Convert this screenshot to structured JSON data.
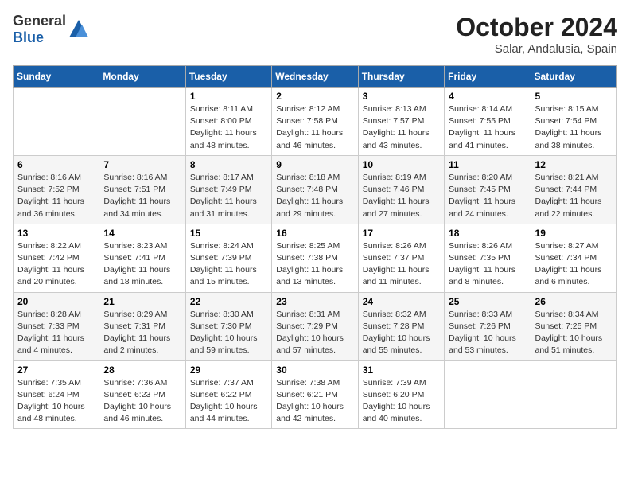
{
  "header": {
    "logo_general": "General",
    "logo_blue": "Blue",
    "month": "October 2024",
    "location": "Salar, Andalusia, Spain"
  },
  "weekdays": [
    "Sunday",
    "Monday",
    "Tuesday",
    "Wednesday",
    "Thursday",
    "Friday",
    "Saturday"
  ],
  "weeks": [
    [
      {
        "day": "",
        "info": ""
      },
      {
        "day": "",
        "info": ""
      },
      {
        "day": "1",
        "info": "Sunrise: 8:11 AM\nSunset: 8:00 PM\nDaylight: 11 hours and 48 minutes."
      },
      {
        "day": "2",
        "info": "Sunrise: 8:12 AM\nSunset: 7:58 PM\nDaylight: 11 hours and 46 minutes."
      },
      {
        "day": "3",
        "info": "Sunrise: 8:13 AM\nSunset: 7:57 PM\nDaylight: 11 hours and 43 minutes."
      },
      {
        "day": "4",
        "info": "Sunrise: 8:14 AM\nSunset: 7:55 PM\nDaylight: 11 hours and 41 minutes."
      },
      {
        "day": "5",
        "info": "Sunrise: 8:15 AM\nSunset: 7:54 PM\nDaylight: 11 hours and 38 minutes."
      }
    ],
    [
      {
        "day": "6",
        "info": "Sunrise: 8:16 AM\nSunset: 7:52 PM\nDaylight: 11 hours and 36 minutes."
      },
      {
        "day": "7",
        "info": "Sunrise: 8:16 AM\nSunset: 7:51 PM\nDaylight: 11 hours and 34 minutes."
      },
      {
        "day": "8",
        "info": "Sunrise: 8:17 AM\nSunset: 7:49 PM\nDaylight: 11 hours and 31 minutes."
      },
      {
        "day": "9",
        "info": "Sunrise: 8:18 AM\nSunset: 7:48 PM\nDaylight: 11 hours and 29 minutes."
      },
      {
        "day": "10",
        "info": "Sunrise: 8:19 AM\nSunset: 7:46 PM\nDaylight: 11 hours and 27 minutes."
      },
      {
        "day": "11",
        "info": "Sunrise: 8:20 AM\nSunset: 7:45 PM\nDaylight: 11 hours and 24 minutes."
      },
      {
        "day": "12",
        "info": "Sunrise: 8:21 AM\nSunset: 7:44 PM\nDaylight: 11 hours and 22 minutes."
      }
    ],
    [
      {
        "day": "13",
        "info": "Sunrise: 8:22 AM\nSunset: 7:42 PM\nDaylight: 11 hours and 20 minutes."
      },
      {
        "day": "14",
        "info": "Sunrise: 8:23 AM\nSunset: 7:41 PM\nDaylight: 11 hours and 18 minutes."
      },
      {
        "day": "15",
        "info": "Sunrise: 8:24 AM\nSunset: 7:39 PM\nDaylight: 11 hours and 15 minutes."
      },
      {
        "day": "16",
        "info": "Sunrise: 8:25 AM\nSunset: 7:38 PM\nDaylight: 11 hours and 13 minutes."
      },
      {
        "day": "17",
        "info": "Sunrise: 8:26 AM\nSunset: 7:37 PM\nDaylight: 11 hours and 11 minutes."
      },
      {
        "day": "18",
        "info": "Sunrise: 8:26 AM\nSunset: 7:35 PM\nDaylight: 11 hours and 8 minutes."
      },
      {
        "day": "19",
        "info": "Sunrise: 8:27 AM\nSunset: 7:34 PM\nDaylight: 11 hours and 6 minutes."
      }
    ],
    [
      {
        "day": "20",
        "info": "Sunrise: 8:28 AM\nSunset: 7:33 PM\nDaylight: 11 hours and 4 minutes."
      },
      {
        "day": "21",
        "info": "Sunrise: 8:29 AM\nSunset: 7:31 PM\nDaylight: 11 hours and 2 minutes."
      },
      {
        "day": "22",
        "info": "Sunrise: 8:30 AM\nSunset: 7:30 PM\nDaylight: 10 hours and 59 minutes."
      },
      {
        "day": "23",
        "info": "Sunrise: 8:31 AM\nSunset: 7:29 PM\nDaylight: 10 hours and 57 minutes."
      },
      {
        "day": "24",
        "info": "Sunrise: 8:32 AM\nSunset: 7:28 PM\nDaylight: 10 hours and 55 minutes."
      },
      {
        "day": "25",
        "info": "Sunrise: 8:33 AM\nSunset: 7:26 PM\nDaylight: 10 hours and 53 minutes."
      },
      {
        "day": "26",
        "info": "Sunrise: 8:34 AM\nSunset: 7:25 PM\nDaylight: 10 hours and 51 minutes."
      }
    ],
    [
      {
        "day": "27",
        "info": "Sunrise: 7:35 AM\nSunset: 6:24 PM\nDaylight: 10 hours and 48 minutes."
      },
      {
        "day": "28",
        "info": "Sunrise: 7:36 AM\nSunset: 6:23 PM\nDaylight: 10 hours and 46 minutes."
      },
      {
        "day": "29",
        "info": "Sunrise: 7:37 AM\nSunset: 6:22 PM\nDaylight: 10 hours and 44 minutes."
      },
      {
        "day": "30",
        "info": "Sunrise: 7:38 AM\nSunset: 6:21 PM\nDaylight: 10 hours and 42 minutes."
      },
      {
        "day": "31",
        "info": "Sunrise: 7:39 AM\nSunset: 6:20 PM\nDaylight: 10 hours and 40 minutes."
      },
      {
        "day": "",
        "info": ""
      },
      {
        "day": "",
        "info": ""
      }
    ]
  ]
}
